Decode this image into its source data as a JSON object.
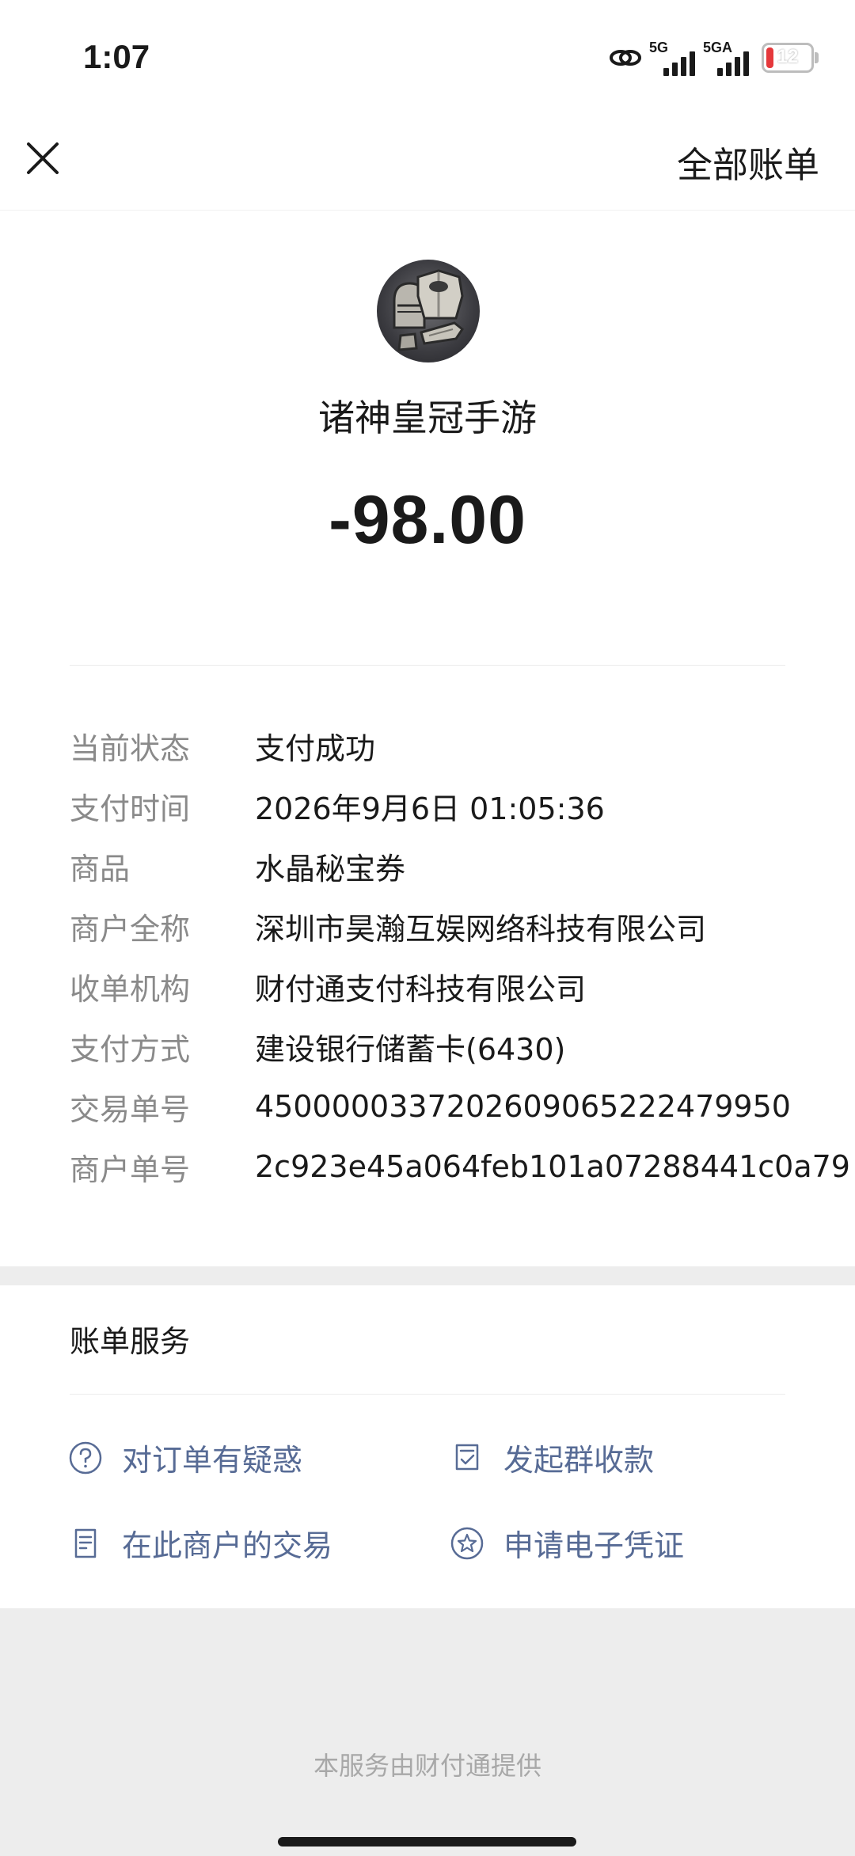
{
  "status_bar": {
    "time": "1:07",
    "network_1": "5G",
    "network_2": "5GA",
    "battery": "12",
    "colors": {
      "battery_low": "#e5383b"
    }
  },
  "nav": {
    "close_icon": "close-icon",
    "all_bills": "全部账单"
  },
  "header": {
    "avatar_icon": "knight-armor-avatar",
    "merchant_name": "诸神皇冠手游",
    "amount": "-98.00"
  },
  "details": [
    {
      "label": "当前状态",
      "value": "支付成功"
    },
    {
      "label": "支付时间",
      "value": "2026年9月6日 01:05:36"
    },
    {
      "label": "商品",
      "value": "水晶秘宝券"
    },
    {
      "label": "商户全称",
      "value": "深圳市昊瀚互娱网络科技有限公司"
    },
    {
      "label": "收单机构",
      "value": "财付通支付科技有限公司"
    },
    {
      "label": "支付方式",
      "value": "建设银行储蓄卡(6430)"
    },
    {
      "label": "交易单号",
      "value": "4500000337202609065222479950"
    },
    {
      "label": "商户单号",
      "value": "2c923e45a064feb101a07288441c0a79"
    }
  ],
  "services": {
    "title": "账单服务",
    "link_color": "#576b95",
    "items": [
      {
        "label": "对订单有疑惑",
        "icon": "question-circle-icon"
      },
      {
        "label": "发起群收款",
        "icon": "group-collect-icon"
      },
      {
        "label": "在此商户的交易",
        "icon": "document-list-icon"
      },
      {
        "label": "申请电子凭证",
        "icon": "star-badge-icon"
      }
    ]
  },
  "footer": {
    "text": "本服务由财付通提供"
  }
}
